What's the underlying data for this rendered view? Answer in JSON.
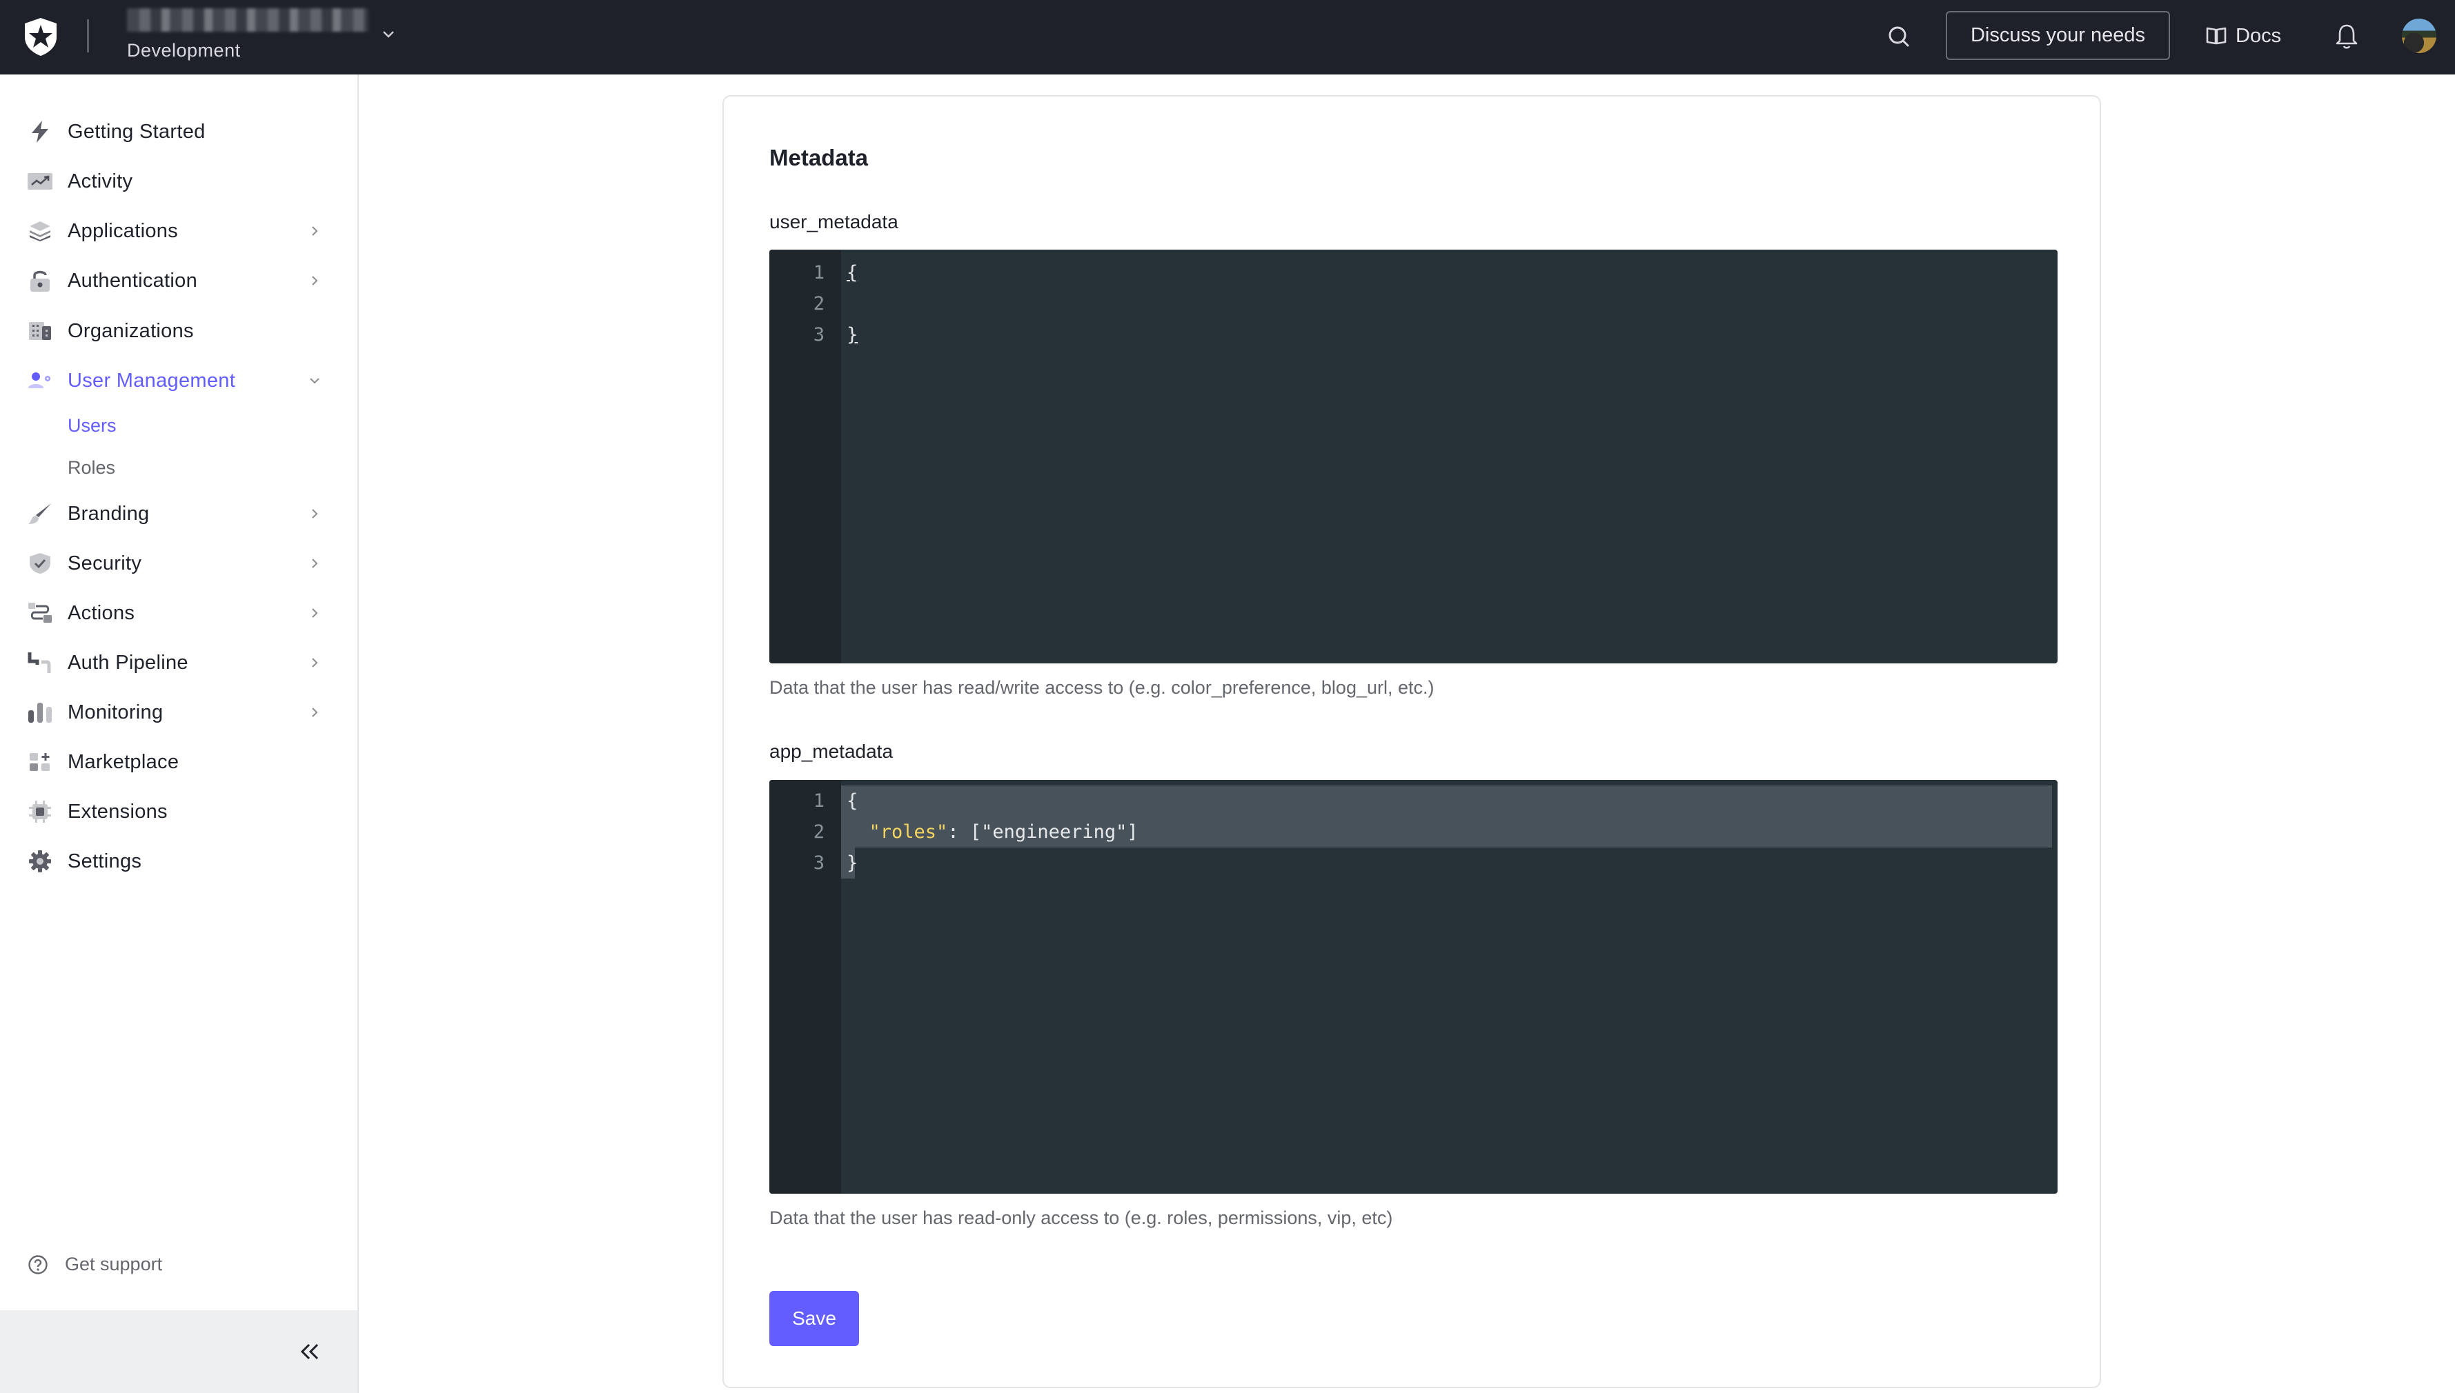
{
  "header": {
    "tenant_name_redacted": "",
    "environment": "Development",
    "discuss_label": "Discuss your needs",
    "docs_label": "Docs"
  },
  "sidebar": {
    "items": [
      {
        "label": "Getting Started",
        "icon": "lightning-icon",
        "chevron": false
      },
      {
        "label": "Activity",
        "icon": "activity-chart-icon",
        "chevron": false
      },
      {
        "label": "Applications",
        "icon": "layers-icon",
        "chevron": true
      },
      {
        "label": "Authentication",
        "icon": "unlock-icon",
        "chevron": true
      },
      {
        "label": "Organizations",
        "icon": "building-icon",
        "chevron": false
      },
      {
        "label": "User Management",
        "icon": "user-gear-icon",
        "chevron": "down",
        "active": true
      },
      {
        "label": "Branding",
        "icon": "brush-icon",
        "chevron": true
      },
      {
        "label": "Security",
        "icon": "shield-check-icon",
        "chevron": true
      },
      {
        "label": "Actions",
        "icon": "flow-icon",
        "chevron": true
      },
      {
        "label": "Auth Pipeline",
        "icon": "pipe-icon",
        "chevron": true
      },
      {
        "label": "Monitoring",
        "icon": "bar-chart-icon",
        "chevron": true
      },
      {
        "label": "Marketplace",
        "icon": "grid-plus-icon",
        "chevron": false
      },
      {
        "label": "Extensions",
        "icon": "chip-icon",
        "chevron": false
      },
      {
        "label": "Settings",
        "icon": "gear-icon",
        "chevron": false
      }
    ],
    "sub_items": [
      {
        "label": "Users",
        "active": true
      },
      {
        "label": "Roles",
        "active": false
      }
    ],
    "support_label": "Get support"
  },
  "main": {
    "title": "Metadata",
    "user_metadata": {
      "label": "user_metadata",
      "lines": [
        "{",
        "",
        "}"
      ],
      "helper": "Data that the user has read/write access to (e.g. color_preference, blog_url, etc.)"
    },
    "app_metadata": {
      "label": "app_metadata",
      "lines": [
        "{",
        "  \"roles\": [\"engineering\"]",
        "}"
      ],
      "key": "\"roles\"",
      "rest": ": [\"engineering\"]",
      "helper": "Data that the user has read-only access to (e.g. roles, permissions, vip, etc)"
    },
    "save_label": "Save"
  },
  "colors": {
    "accent": "#635dff",
    "header_bg": "#1e212a",
    "editor_bg": "#263238",
    "editor_gutter": "#1f272c",
    "json_key": "#f4d35e"
  }
}
